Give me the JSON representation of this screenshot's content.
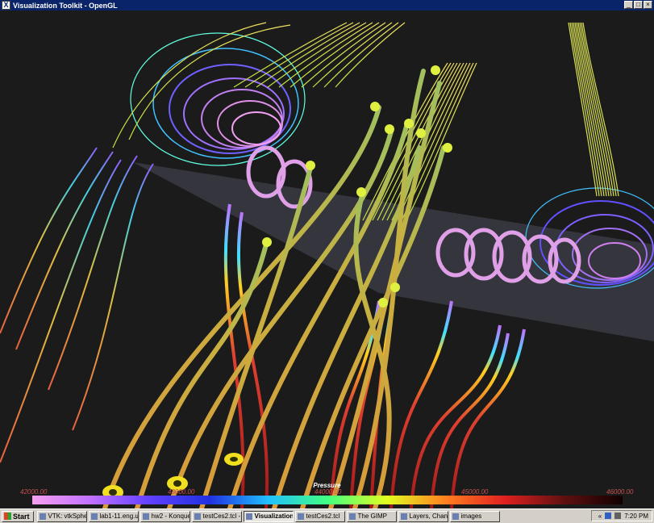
{
  "window": {
    "title": "Visualization Toolkit - OpenGL",
    "icon": "vtk-icon",
    "minimize": "_",
    "maximize": "□",
    "close": "×"
  },
  "legend": {
    "title": "Pressure",
    "labels": [
      "42000.00",
      "43000.00",
      "44000.00",
      "45000.00",
      "46000.00"
    ],
    "colors": [
      "#f5a0f0",
      "#c070ff",
      "#6040ff",
      "#2030e0",
      "#20c0ff",
      "#40ff80",
      "#e0ff20",
      "#ff8020",
      "#e02020",
      "#601010",
      "#100000"
    ]
  },
  "taskbar": {
    "start": "Start",
    "tasks": [
      {
        "label": "VTK: vtkSpher...",
        "icon": "firefox-icon"
      },
      {
        "label": "lab1-11.eng.ut...",
        "icon": "terminal-icon"
      },
      {
        "label": "hw2 - Konqueror",
        "icon": "konqueror-icon"
      },
      {
        "label": "testCes2.tcl - ...",
        "icon": "editor-icon"
      },
      {
        "label": "Visualization ...",
        "icon": "vtk-icon",
        "active": true
      },
      {
        "label": "testCes2.tcl",
        "icon": "vtk-icon"
      },
      {
        "label": "The GIMP",
        "icon": "gimp-icon"
      },
      {
        "label": "Layers, Chann...",
        "icon": "gimp-icon"
      },
      {
        "label": "images",
        "icon": "folder-icon"
      }
    ],
    "tray_arrow": "«",
    "time": "7:20 PM"
  }
}
